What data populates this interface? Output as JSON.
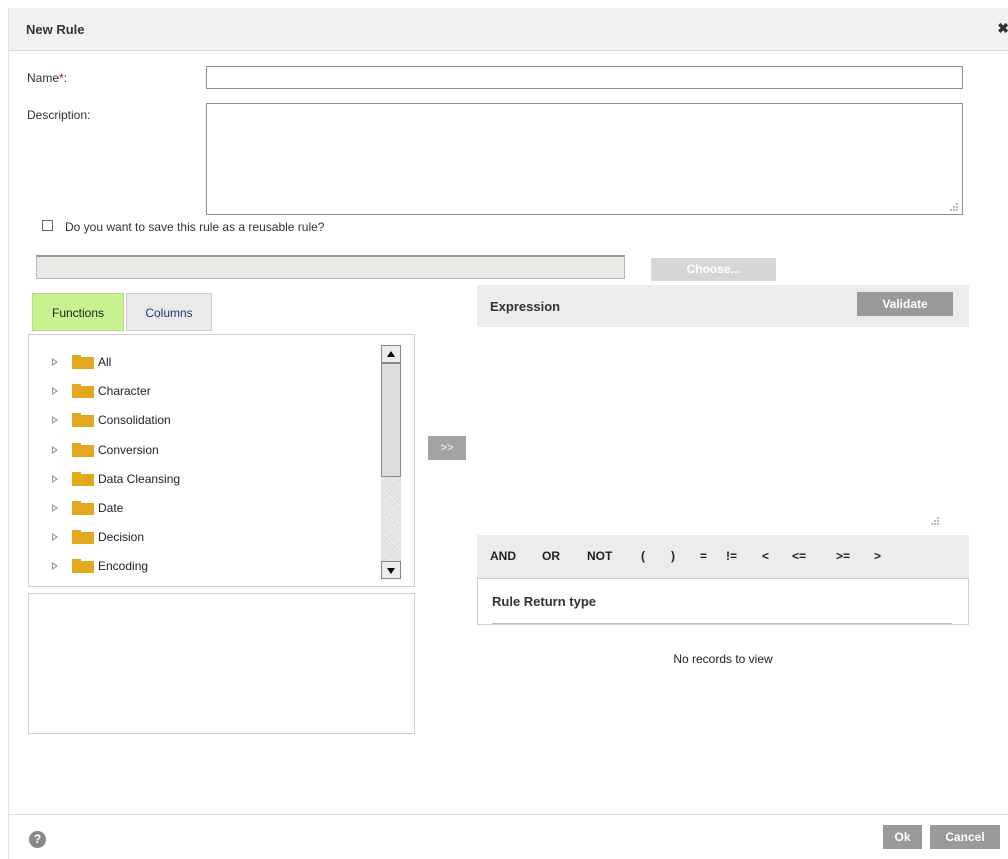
{
  "dialog": {
    "title": "New Rule",
    "close_glyph": "✖"
  },
  "form": {
    "name_label": "Name",
    "required_mark": "*",
    "name_label_suffix": ":",
    "name_value": "",
    "description_label": "Description:",
    "description_value": "",
    "reusable_label": "Do you want to save this rule as a reusable rule?",
    "reusable_checked": false,
    "choose_value": "",
    "choose_label": "Choose..."
  },
  "tabs": [
    {
      "label": "Functions",
      "active": true
    },
    {
      "label": "Columns",
      "active": false
    }
  ],
  "tree": {
    "items": [
      {
        "label": "All"
      },
      {
        "label": "Character"
      },
      {
        "label": "Consolidation"
      },
      {
        "label": "Conversion"
      },
      {
        "label": "Data Cleansing"
      },
      {
        "label": "Date"
      },
      {
        "label": "Decision"
      },
      {
        "label": "Encoding"
      }
    ]
  },
  "add_button_label": ">>",
  "expression": {
    "title": "Expression",
    "validate_label": "Validate",
    "value": "",
    "operators": [
      "AND",
      "OR",
      "NOT",
      "(",
      ")",
      "=",
      "!=",
      "<",
      "<=",
      ">=",
      ">"
    ]
  },
  "return_type": {
    "title": "Rule Return type",
    "empty_message": "No records to view"
  },
  "footer": {
    "help_glyph": "?",
    "ok_label": "Ok",
    "cancel_label": "Cancel"
  },
  "colors": {
    "tab_active_bg": "#c8f190",
    "folder": "#e3a91e",
    "button_bg": "#9a9a9a",
    "required": "#d0021b"
  },
  "icons": {
    "close": "close-icon",
    "folder": "folder-icon",
    "expand": "expand-arrow-icon",
    "help": "help-icon",
    "checkbox": "checkbox-icon",
    "resize": "resize-grip-icon"
  }
}
